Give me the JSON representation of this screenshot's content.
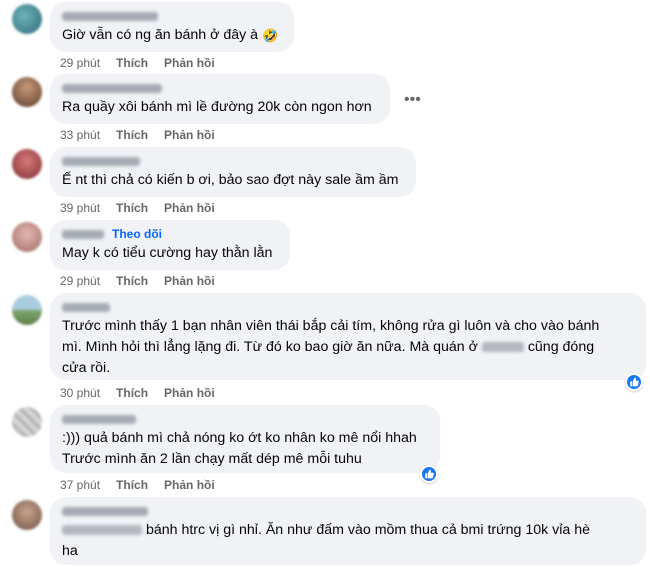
{
  "comments": [
    {
      "text": "Giờ vẫn có ng ăn bánh ở đây à",
      "emoji": "🤣",
      "time": "29 phút",
      "like": "Thích",
      "reply": "Phản hồi"
    },
    {
      "text": "Ra quầy xôi bánh mì lề đường 20k còn ngon hơn",
      "time": "33 phút",
      "like": "Thích",
      "reply": "Phản hồi"
    },
    {
      "text": "Ế nt thì chả có kiến b ơi, bảo sao đợt này sale ầm ầm",
      "time": "39 phút",
      "like": "Thích",
      "reply": "Phản hồi"
    },
    {
      "follow": "Theo dõi",
      "text": "May k có tiểu cường hay thằn lằn",
      "time": "29 phút",
      "like": "Thích",
      "reply": "Phản hồi"
    },
    {
      "line1": "Trước mình thấy 1 bạn nhân viên thái bắp cải tím, không rửa gì luôn và cho vào bánh",
      "line2": "mì. Mình hỏi thì lẳng lặng đi. Từ đó ko bao giờ ăn nữa. Mà quán ở",
      "line2b": "cũng đóng",
      "line3": "cửa rồi.",
      "time": "30 phút",
      "like": "Thích",
      "reply": "Phản hồi"
    },
    {
      "line1": ":))) quả bánh mì chả nóng ko ớt ko nhân ko mê nổi hhah",
      "line2": "Trước mình ăn 2 lần chạy mất dép mê mỗi tuhu",
      "time": "37 phút",
      "like": "Thích",
      "reply": "Phản hồi"
    },
    {
      "line1": "bánh htrc vị gì nhỉ. Ăn như đấm vào mồm thua cả bmi trứng 10k vỉa hè",
      "line2": "ha"
    }
  ],
  "more_glyph": "•••",
  "colors": {
    "bubble": "#f0f2f5",
    "meta": "#65676b",
    "link": "#0866ff",
    "like": "#1877f2"
  }
}
